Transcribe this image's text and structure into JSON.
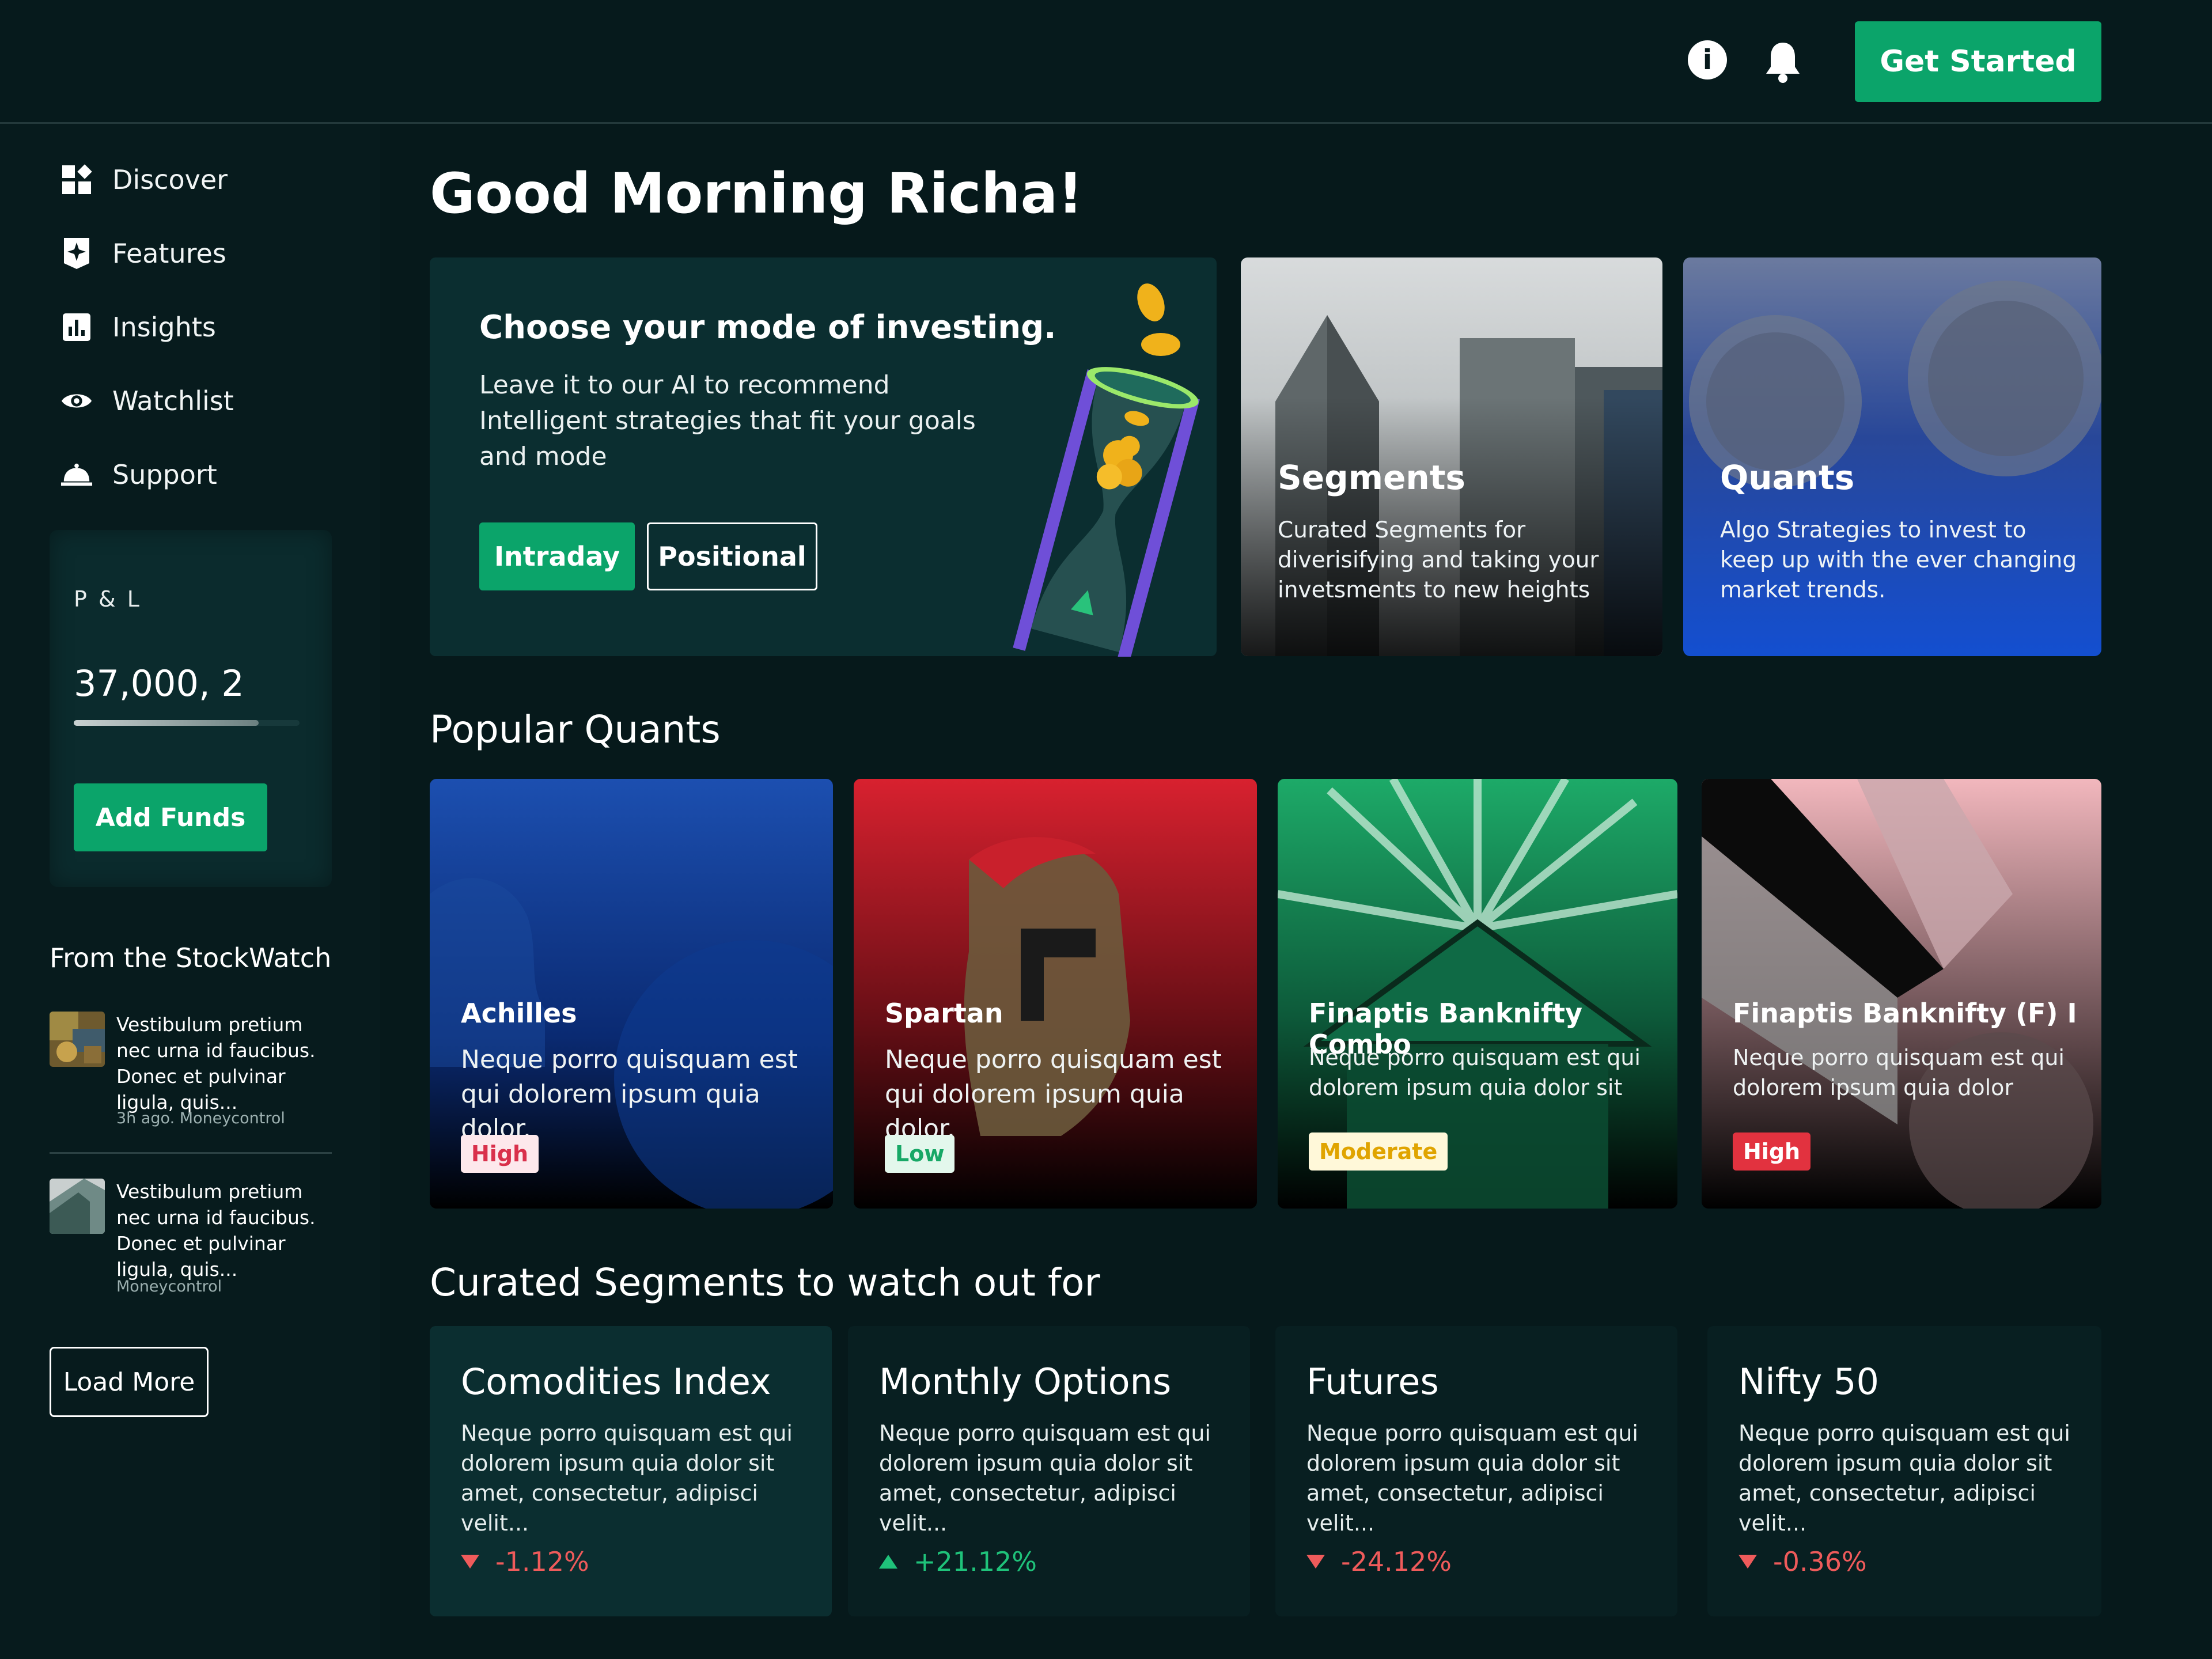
{
  "topbar": {
    "info_icon": "info-icon",
    "bell_icon": "bell-icon",
    "get_started_label": "Get Started"
  },
  "sidebar": {
    "items": [
      {
        "label": "Discover",
        "icon": "dashboard-icon"
      },
      {
        "label": "Features",
        "icon": "sparkle-icon"
      },
      {
        "label": "Insights",
        "icon": "bar-chart-icon"
      },
      {
        "label": "Watchlist",
        "icon": "eye-icon"
      },
      {
        "label": "Support",
        "icon": "service-bell-icon"
      }
    ],
    "pnl": {
      "label": "P & L",
      "value": "37,000, 2",
      "progress_fraction": 0.82,
      "add_funds_label": "Add Funds"
    },
    "stockwatch": {
      "title": "From the StockWatch",
      "news": [
        {
          "headline": "Vestibulum pretium nec urna id faucibus. Donec et pulvinar ligula, quis...",
          "meta": "3h ago. Moneycontrol"
        },
        {
          "headline": "Vestibulum pretium nec urna id faucibus. Donec et pulvinar ligula, quis...",
          "meta": "Moneycontrol"
        }
      ],
      "load_more_label": "Load More"
    }
  },
  "main": {
    "greeting": "Good Morning Richa!",
    "hero": {
      "title": "Choose your mode of investing.",
      "description": "Leave it to our AI to recommend Intelligent strategies that fit your goals and mode",
      "intraday_label": "Intraday",
      "positional_label": "Positional"
    },
    "features": [
      {
        "title": "Segments",
        "description": "Curated Segments for diverisifying and taking your invetsments  to new heights"
      },
      {
        "title": "Quants",
        "description": "Algo Strategies to invest to keep up with the ever changing market trends."
      }
    ],
    "popular_quants": {
      "title": "Popular Quants",
      "items": [
        {
          "name": "Achilles",
          "description": "Neque porro quisquam est qui dolorem ipsum quia dolor.",
          "risk": "High"
        },
        {
          "name": "Spartan",
          "description": "Neque porro quisquam est qui dolorem ipsum quia dolor.",
          "risk": "Low"
        },
        {
          "name": "Finaptis Banknifty Combo",
          "description": "Neque porro quisquam est qui dolorem ipsum quia dolor sit",
          "risk": "Moderate"
        },
        {
          "name": "Finaptis Banknifty (F) I",
          "description": "Neque porro quisquam est qui dolorem ipsum quia dolor",
          "risk": "High"
        }
      ]
    },
    "curated_segments": {
      "title": "Curated Segments to watch out for",
      "items": [
        {
          "name": "Comodities Index",
          "description": "Neque porro quisquam est qui dolorem ipsum quia dolor sit amet, consectetur, adipisci velit...",
          "change": "-1.12%",
          "direction": "down"
        },
        {
          "name": "Monthly Options",
          "description": "Neque porro quisquam est qui dolorem ipsum quia dolor sit amet, consectetur, adipisci velit...",
          "change": "+21.12%",
          "direction": "up"
        },
        {
          "name": "Futures",
          "description": "Neque porro quisquam est qui dolorem ipsum quia dolor sit amet, consectetur, adipisci velit...",
          "change": "-24.12%",
          "direction": "down"
        },
        {
          "name": "Nifty 50",
          "description": "Neque porro quisquam est qui dolorem ipsum quia dolor sit amet, consectetur, adipisci velit...",
          "change": "-0.36%",
          "direction": "down"
        }
      ]
    }
  },
  "colors": {
    "background": "#06191b",
    "accent_green": "#0ba46a",
    "negative": "#ef5b5b",
    "positive": "#1fc27a",
    "risk_high": "#d9304b",
    "risk_low": "#17a866",
    "risk_moderate": "#e0a400"
  }
}
